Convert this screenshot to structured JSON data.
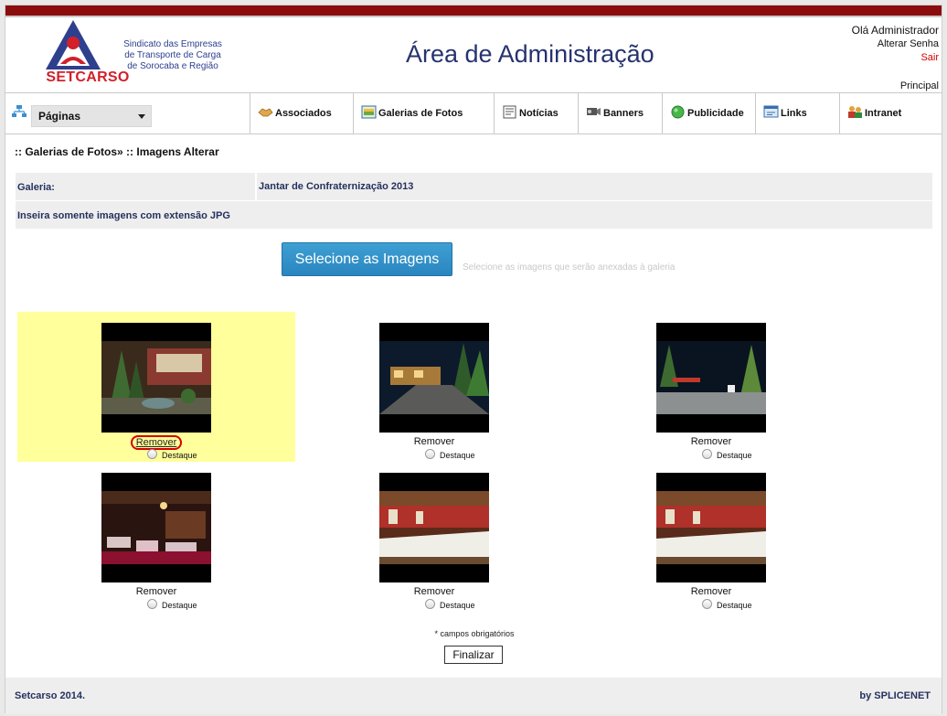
{
  "header": {
    "logo_subtitle_lines": [
      "Sindicato das Empresas",
      "de Transporte de Carga",
      "de Sorocaba e Região"
    ],
    "logo_name": "SETCARSO",
    "page_title": "Área de Administração",
    "user_greeting": "Olá Administrador",
    "change_password": "Alterar Senha",
    "logout": "Sair",
    "principal_link": "Principal"
  },
  "nav": {
    "pages_select": "Páginas",
    "items": [
      {
        "label": "Associados",
        "icon": "handshake-icon"
      },
      {
        "label": "Galerias de Fotos",
        "icon": "photo-gallery-icon"
      },
      {
        "label": "Notícias",
        "icon": "news-icon"
      },
      {
        "label": "Banners",
        "icon": "projector-icon"
      },
      {
        "label": "Publicidade",
        "icon": "green-globe-icon"
      },
      {
        "label": "Links",
        "icon": "links-icon"
      },
      {
        "label": "Intranet",
        "icon": "users-icon"
      }
    ]
  },
  "breadcrumb": ":: Galerias de Fotos» :: Imagens Alterar",
  "form": {
    "gallery_label": "Galeria:",
    "gallery_value": "Jantar de Confraternização 2013",
    "jpg_note": "Inseira somente imagens com extensão JPG",
    "select_button": "Selecione as Imagens",
    "select_hint": "Selecione as imagens que serão anexadas à galeria"
  },
  "gallery": {
    "remove_label": "Remover",
    "destaque_label": "Destaque",
    "images": [
      {
        "scene": "courtyard-garden-fountain",
        "highlighted": true
      },
      {
        "scene": "night-front-path"
      },
      {
        "scene": "night-driveway-palm"
      },
      {
        "scene": "restaurant-hall-tables"
      },
      {
        "scene": "banquet-buffet-hall"
      },
      {
        "scene": "banquet-buffet-hall"
      }
    ]
  },
  "required_note": "* campos obrigatórios",
  "finalize_button": "Finalizar",
  "footer": {
    "left": "Setcarso 2014.",
    "right": "by SPLICENET"
  },
  "colors": {
    "top_bar": "#8b0d0d",
    "title_blue": "#26336f",
    "logo_red": "#d31f2a",
    "button_blue": "#2a85bf",
    "highlight_yellow": "#ffff9c"
  }
}
